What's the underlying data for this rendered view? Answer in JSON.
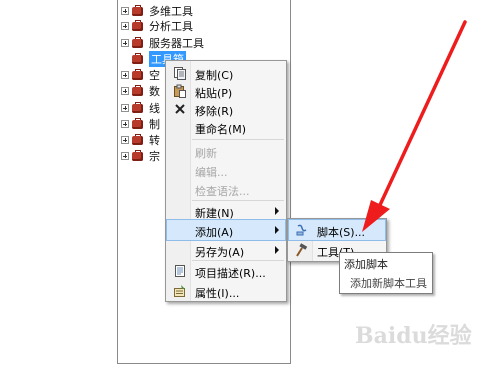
{
  "tree": {
    "items": [
      {
        "label": "多维工具",
        "expanded": false
      },
      {
        "label": "分析工具",
        "expanded": false
      },
      {
        "label": "服务器工具",
        "expanded": false
      },
      {
        "label": "工具箱",
        "selected": true
      },
      {
        "label": "空"
      },
      {
        "label": "数"
      },
      {
        "label": "线"
      },
      {
        "label": "制"
      },
      {
        "label": "转"
      },
      {
        "label": "宗"
      }
    ]
  },
  "context_menu": {
    "items": [
      {
        "label": "复制(C)",
        "icon": "copy-icon",
        "enabled": true
      },
      {
        "label": "粘贴(P)",
        "icon": "paste-icon",
        "enabled": true
      },
      {
        "label": "移除(R)",
        "icon": "remove-icon",
        "enabled": true
      },
      {
        "label": "重命名(M)",
        "enabled": true
      },
      {
        "label": "刷新",
        "enabled": false
      },
      {
        "label": "编辑...",
        "enabled": false
      },
      {
        "label": "检查语法...",
        "enabled": false
      },
      {
        "label": "新建(N)",
        "submenu": true
      },
      {
        "label": "添加(A)",
        "submenu": true,
        "highlighted": true
      },
      {
        "label": "另存为(A)",
        "submenu": true
      },
      {
        "label": "项目描述(R)...",
        "icon": "description-icon"
      },
      {
        "label": "属性(I)...",
        "icon": "properties-icon"
      }
    ]
  },
  "submenu": {
    "items": [
      {
        "label": "脚本(S)...",
        "icon": "script-icon",
        "highlighted": true
      },
      {
        "label": "工具(T)...",
        "icon": "hammer-icon"
      }
    ]
  },
  "tooltip": {
    "title": "添加脚本",
    "description": "添加新脚本工具"
  },
  "annotation": {
    "color": "#ee1c1c"
  },
  "watermark": {
    "text": "Baidu经验"
  },
  "colors": {
    "selection": "#3399ff",
    "menu_highlight": "#d6e8fb",
    "toolbox_red": "#b73a2b"
  }
}
